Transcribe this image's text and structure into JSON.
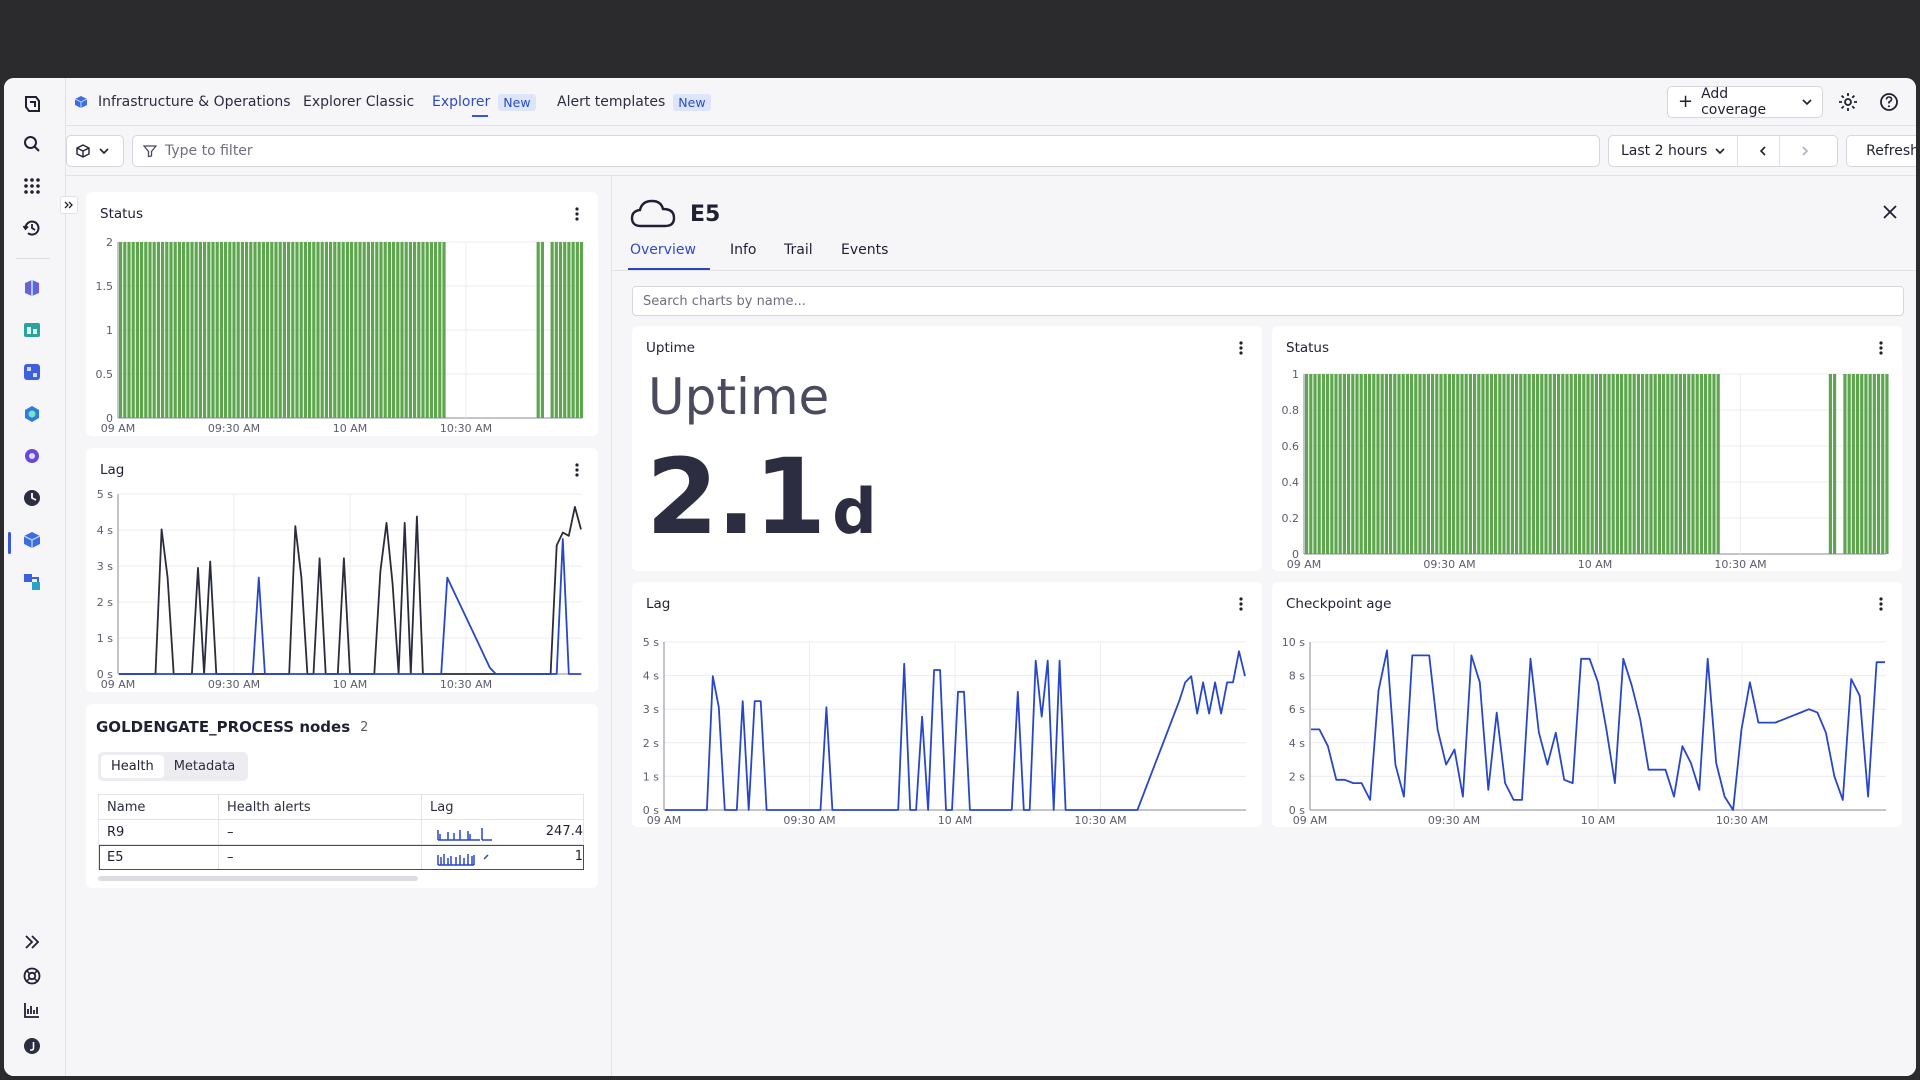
{
  "topbar": {
    "app_title": "Infrastructure & Operations",
    "nav_classic": "Explorer Classic",
    "nav_explorer": "Explorer",
    "nav_alerts": "Alert templates",
    "new_badge": "New",
    "add_coverage": "Add coverage"
  },
  "filterbar": {
    "placeholder": "Type to filter",
    "timeframe": "Last 2 hours",
    "refresh": "Refresh"
  },
  "left": {
    "status_title": "Status",
    "lag_title": "Lag",
    "nodes_title": "GOLDENGATE_PROCESS nodes",
    "nodes_count": "2",
    "tab_health": "Health",
    "tab_metadata": "Metadata",
    "columns": [
      "Name",
      "Health alerts",
      "Lag"
    ],
    "rows": [
      {
        "name": "R9",
        "alerts": "–",
        "value": "247.4"
      },
      {
        "name": "E5",
        "alerts": "–",
        "value": "1"
      }
    ]
  },
  "detail": {
    "entity": "E5",
    "tabs": [
      "Overview",
      "Info",
      "Trail",
      "Events"
    ],
    "search_placeholder": "Search charts by name...",
    "uptime_title": "Uptime",
    "uptime_label": "Uptime",
    "uptime_value": "2.1",
    "uptime_unit": "d",
    "status_title": "Status",
    "lag_title": "Lag",
    "checkpoint_title": "Checkpoint age"
  },
  "chart_data": [
    {
      "id": "left-status",
      "type": "bar",
      "x_ticks": [
        "09 AM",
        "09:30 AM",
        "10 AM",
        "10:30 AM"
      ],
      "y_ticks": [
        "0",
        "0.5",
        "1",
        "1.5",
        "2"
      ],
      "ylim": [
        0,
        2
      ],
      "segments": [
        [
          0,
          0.7,
          2
        ],
        [
          0.9,
          0.92,
          2
        ],
        [
          0.93,
          1.0,
          2
        ]
      ],
      "color": "#5ea64e"
    },
    {
      "id": "left-lag",
      "type": "line",
      "x_ticks": [
        "09 AM",
        "09:30 AM",
        "10 AM",
        "10:30 AM"
      ],
      "y_ticks": [
        "0 s",
        "1 s",
        "2 s",
        "3 s",
        "4 s",
        "5 s"
      ],
      "ylim": [
        0,
        5.6
      ],
      "series": [
        {
          "color": "#2a2b3c",
          "values": [
            0,
            0,
            0,
            0,
            0,
            0,
            0,
            4.5,
            3,
            0,
            0,
            0,
            0,
            3.3,
            0,
            3.5,
            0,
            0,
            0,
            0,
            0,
            0,
            0,
            0,
            0,
            0,
            0,
            0,
            0,
            4.6,
            3,
            0,
            0,
            3.6,
            0,
            0,
            0,
            3.6,
            0,
            0,
            0,
            0,
            0,
            3.2,
            4.7,
            2.8,
            0,
            4.7,
            0,
            4.9,
            0,
            0,
            0,
            0,
            0,
            0,
            0,
            0,
            0,
            0,
            0,
            0,
            0,
            0,
            0,
            0,
            0,
            0,
            0,
            0,
            0,
            0,
            4,
            4.4,
            4.3,
            5.2,
            4.5
          ]
        },
        {
          "color": "#2847c8",
          "values": [
            0,
            0,
            0,
            0,
            0,
            0,
            0,
            0,
            0,
            0,
            0,
            0,
            0,
            0,
            0,
            0,
            0,
            0,
            0,
            0,
            0,
            0,
            0,
            3,
            0,
            0,
            0,
            0,
            0,
            0,
            0,
            0,
            0,
            0,
            0,
            0,
            0,
            0,
            0,
            0,
            0,
            0,
            0,
            0,
            0,
            0,
            0,
            0,
            0,
            0,
            0,
            0,
            0,
            0,
            3,
            2.6,
            2.2,
            1.8,
            1.4,
            1,
            0.6,
            0.2,
            0,
            0,
            0,
            0,
            0,
            0,
            0,
            0,
            0,
            0,
            0,
            4.2,
            0,
            0,
            0
          ]
        }
      ]
    },
    {
      "id": "detail-status",
      "type": "bar",
      "x_ticks": [
        "09 AM",
        "09:30 AM",
        "10 AM",
        "10:30 AM"
      ],
      "y_ticks": [
        "0",
        "0.2",
        "0.4",
        "0.6",
        "0.8",
        "1"
      ],
      "ylim": [
        0,
        1
      ],
      "segments": [
        [
          0,
          0.71,
          1
        ],
        [
          0.9,
          0.915,
          1
        ],
        [
          0.925,
          1.0,
          1
        ]
      ],
      "color": "#5ea64e"
    },
    {
      "id": "detail-lag",
      "type": "line",
      "x_ticks": [
        "09 AM",
        "09:30 AM",
        "10 AM",
        "10:30 AM"
      ],
      "y_ticks": [
        "0 s",
        "1 s",
        "2 s",
        "3 s",
        "4 s",
        "5 s"
      ],
      "ylim": [
        0,
        5.4
      ],
      "series": [
        {
          "color": "#2847c8",
          "values": [
            0,
            0,
            0,
            0,
            0,
            0,
            0,
            0,
            4.3,
            3.3,
            0,
            0,
            0,
            3.5,
            0,
            3.5,
            3.5,
            0,
            0,
            0,
            0,
            0,
            0,
            0,
            0,
            0,
            0,
            3.3,
            0,
            0,
            0,
            0,
            0,
            0,
            0,
            0,
            0,
            0,
            0,
            0,
            4.7,
            0,
            0,
            3,
            0,
            4.5,
            4.5,
            0,
            0,
            3.8,
            3.8,
            0,
            0,
            0,
            0,
            0,
            0,
            0,
            0,
            3.8,
            0,
            0,
            4.8,
            3,
            4.8,
            0,
            4.8,
            0,
            0,
            0,
            0,
            0,
            0,
            0,
            0,
            0,
            0,
            0,
            0,
            0,
            0.5,
            1,
            1.5,
            2,
            2.5,
            3,
            3.5,
            4.1,
            4.3,
            3.1,
            4.1,
            3.1,
            4.1,
            3.1,
            4.1,
            4.1,
            5.1,
            4.3
          ]
        }
      ]
    },
    {
      "id": "detail-checkpoint",
      "type": "line",
      "x_ticks": [
        "09 AM",
        "09:30 AM",
        "10 AM",
        "10:30 AM"
      ],
      "y_ticks": [
        "0 s",
        "2 s",
        "4 s",
        "6 s",
        "8 s",
        "10 s"
      ],
      "ylim": [
        0,
        10
      ],
      "series": [
        {
          "color": "#2847c8",
          "values": [
            4.8,
            4.8,
            3.8,
            1.8,
            1.8,
            1.6,
            1.6,
            0.6,
            7.1,
            9.5,
            2.7,
            0.8,
            9.2,
            9.2,
            9.2,
            4.8,
            2.7,
            3.6,
            0.8,
            9.2,
            7.6,
            1.2,
            5.8,
            1.6,
            0.6,
            0.6,
            9,
            4.6,
            2.7,
            4.6,
            1.8,
            1.6,
            9,
            9,
            7.6,
            4.8,
            1.6,
            9,
            7.4,
            5.4,
            2.4,
            2.4,
            2.4,
            0.8,
            3.8,
            2.8,
            1.2,
            9,
            2.8,
            0.8,
            0,
            4.8,
            7.6,
            5.2,
            5.2,
            5.2,
            5.4,
            5.6,
            5.8,
            6,
            5.8,
            4.6,
            2,
            0.6,
            7.8,
            6.8,
            0.8,
            8.8,
            8.8
          ]
        }
      ]
    }
  ]
}
